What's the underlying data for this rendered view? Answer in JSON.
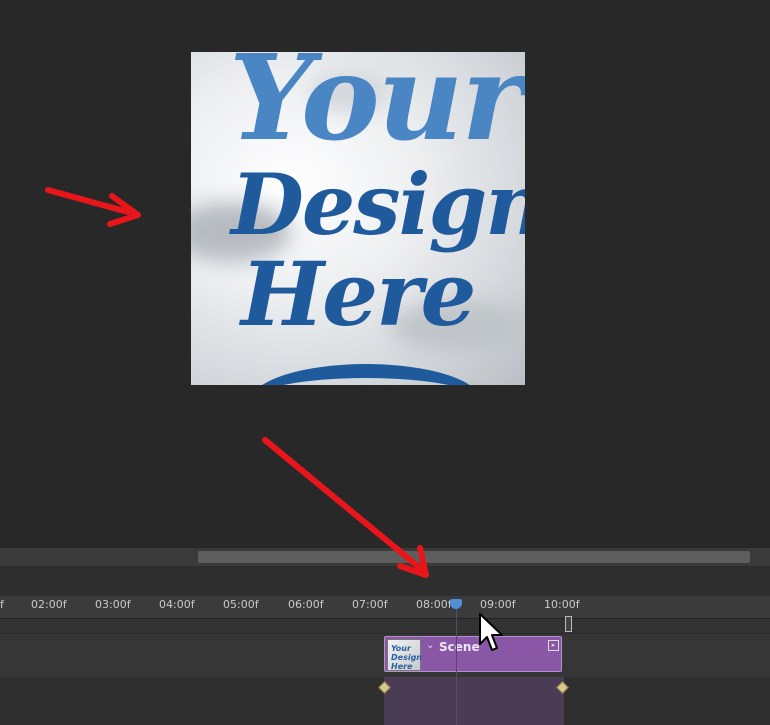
{
  "preview": {
    "design_lines": [
      "Your",
      "Design",
      "Here"
    ]
  },
  "timeline": {
    "ticks": [
      "f",
      "02:00f",
      "03:00f",
      "04:00f",
      "05:00f",
      "06:00f",
      "07:00f",
      "08:00f",
      "09:00f",
      "10:00f"
    ],
    "clip": {
      "label": "Scene",
      "thumb_text": "Your Design Here"
    }
  },
  "colors": {
    "background": "#282828",
    "clip": "#8a57a6",
    "playhead": "#4f8fd6",
    "annotation_arrow": "#e8161b"
  },
  "icons": {
    "arrow1": "red-arrow-icon",
    "arrow2": "red-arrow-icon",
    "cursor": "mouse-pointer-icon",
    "playhead": "playhead-icon"
  }
}
